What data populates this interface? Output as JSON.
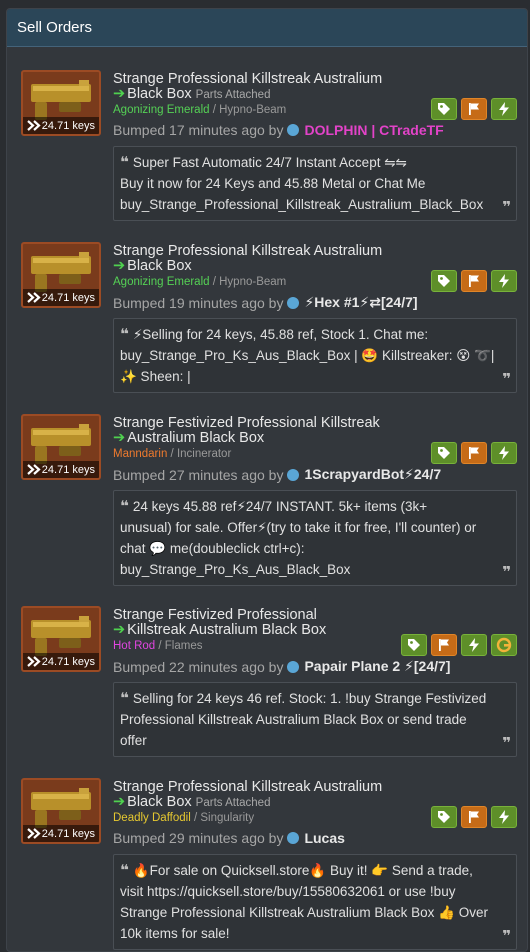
{
  "panel": {
    "title": "Sell Orders"
  },
  "orders": [
    {
      "price": "24.71 keys",
      "title": "Strange Professional Killstreak Australium",
      "title2": "Black Box",
      "subtitle": "Parts Attached",
      "sheen": "Agonizing Emerald",
      "sheen_color": "#55d155",
      "sep": " / ",
      "killstreaker": "Hypno-Beam",
      "bumped": "Bumped 17 minutes ago by",
      "user": "DOLPHIN | CTradeTF",
      "user_color": "#e243c8",
      "msg_lines": [
        "Super Fast Automatic  24/7 Instant Accept ⇋⇋",
        "Buy it now for 24 Keys and 45.88 Metal or Chat Me",
        "buy_Strange_Professional_Killstreak_Australium_Black_Box"
      ]
    },
    {
      "price": "24.71 keys",
      "title": "Strange Professional Killstreak Australium",
      "title2": "Black Box",
      "subtitle": "",
      "sheen": "Agonizing Emerald",
      "sheen_color": "#55d155",
      "sep": " / ",
      "killstreaker": "Hypno-Beam",
      "bumped": "Bumped 19 minutes ago by",
      "user": "⚡Hex #1⚡⇄[24/7]",
      "user_color": "#e8e8e8",
      "msg_lines": [
        "⚡Selling for 24 keys, 45.88 ref, Stock 1. Chat me:",
        "buy_Strange_Pro_Ks_Aus_Black_Box | 🤩 Killstreaker: 😵 ➰|",
        "✨ Sheen:  |"
      ]
    },
    {
      "price": "24.71 keys",
      "title": "Strange Festivized Professional Killstreak",
      "title2": "Australium Black Box",
      "subtitle": "",
      "sheen": "Manndarin",
      "sheen_color": "#ee7a2e",
      "sep": " / ",
      "killstreaker": "Incinerator",
      "bumped": "Bumped 27 minutes ago by",
      "user": "1ScrapyardBot⚡24/7",
      "user_color": "#e8e8e8",
      "msg_lines": [
        "24 keys 45.88 ref⚡24/7 INSTANT. 5k+ items (3k+",
        "unusual) for sale. Offer⚡(try to take it for free, I'll counter) or",
        "chat 💬 me(doubleclick ctrl+c):",
        "buy_Strange_Pro_Ks_Aus_Black_Box"
      ]
    },
    {
      "price": "24.71 keys",
      "title": "Strange Festivized Professional",
      "title2": "Killstreak Australium Black Box",
      "subtitle": "",
      "sheen": "Hot Rod",
      "sheen_color": "#e046e0",
      "sep": " / ",
      "killstreaker": "Flames",
      "bumped": "Bumped 22 minutes ago by",
      "user": "Papair Plane 2 ⚡[24/7]",
      "user_color": "#e8e8e8",
      "msg_lines": [
        "Selling for 24 keys 46 ref. Stock: 1. !buy Strange Festivized",
        "Professional Killstreak Australium Black Box or send trade",
        "offer"
      ]
    },
    {
      "price": "24.71 keys",
      "title": "Strange Professional Killstreak Australium",
      "title2": "Black Box",
      "subtitle": "Parts Attached",
      "sheen": "Deadly Daffodil",
      "sheen_color": "#e6c830",
      "sep": " / ",
      "killstreaker": "Singularity",
      "bumped": "Bumped 29 minutes ago by",
      "user": "Lucas",
      "user_color": "#e8e8e8",
      "msg_lines": [
        "🔥For sale on Quicksell.store🔥 Buy it! 👉 Send a trade,",
        "visit https://quicksell.store/buy/15580632061 or use !buy",
        "Strange Professional Killstreak Australium Black Box 👍 Over",
        "10k items for sale!"
      ]
    }
  ],
  "icons": {
    "tag": "tag-icon",
    "flag": "flag-icon",
    "bolt": "lightning-icon",
    "gift": "gladiator-icon"
  }
}
